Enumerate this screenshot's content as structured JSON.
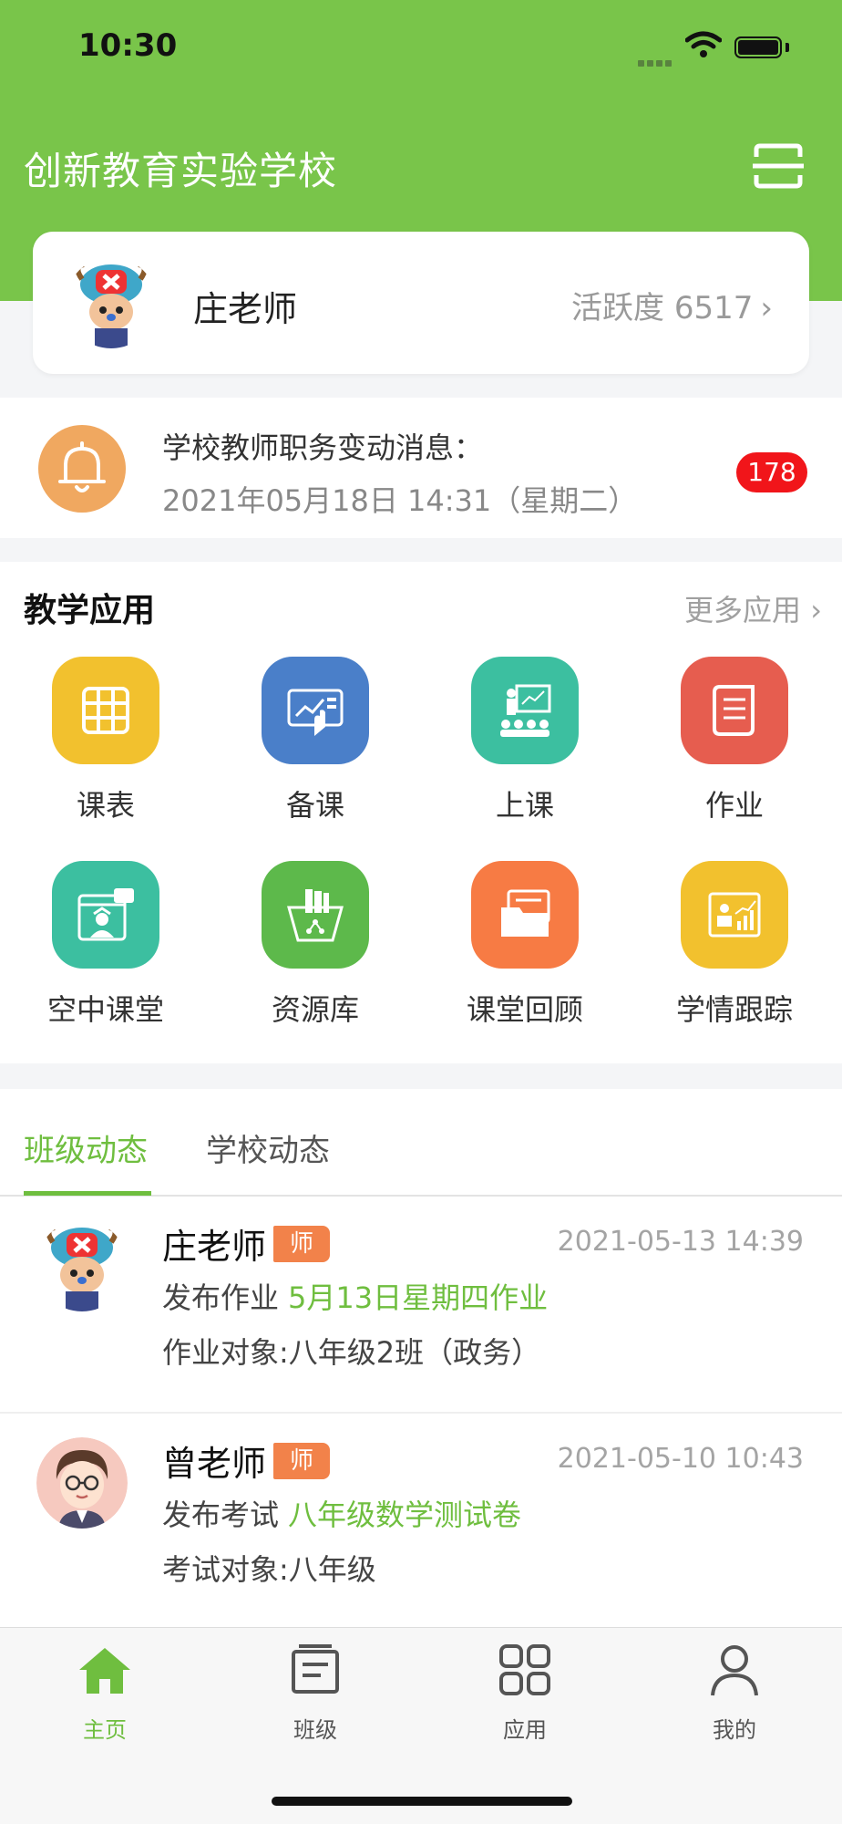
{
  "status_bar": {
    "time": "10:30"
  },
  "header": {
    "school_name": "创新教育实验学校",
    "scan_icon": "scan-icon"
  },
  "profile": {
    "name": "庄老师",
    "activity_label": "活跃度 6517",
    "chevron": "›"
  },
  "notice": {
    "title": "学校教师职务变动消息：",
    "time": "2021年05月18日 14:31（星期二）",
    "badge_count": "178",
    "icon": "bell-icon"
  },
  "apps": {
    "title": "教学应用",
    "more": "更多应用 ›",
    "items": [
      {
        "label": "课表",
        "icon": "timetable-icon",
        "color": "#f2c12e"
      },
      {
        "label": "备课",
        "icon": "lesson-prep-icon",
        "color": "#4a7fc9"
      },
      {
        "label": "上课",
        "icon": "class-icon",
        "color": "#3cbfa0"
      },
      {
        "label": "作业",
        "icon": "homework-icon",
        "color": "#e65d4f"
      },
      {
        "label": "空中课堂",
        "icon": "online-class-icon",
        "color": "#3cbfa0"
      },
      {
        "label": "资源库",
        "icon": "resource-library-icon",
        "color": "#5db94b"
      },
      {
        "label": "课堂回顾",
        "icon": "class-review-icon",
        "color": "#f77b44"
      },
      {
        "label": "学情跟踪",
        "icon": "learning-tracking-icon",
        "color": "#f2c12e"
      }
    ]
  },
  "feed": {
    "tabs": [
      "班级动态",
      "学校动态"
    ],
    "items": [
      {
        "name": "庄老师",
        "role": "师",
        "time": "2021-05-13 14:39",
        "action": "发布作业",
        "link": "5月13日星期四作业",
        "target": "作业对象:八年级2班（政务）"
      },
      {
        "name": "曾老师",
        "role": "师",
        "time": "2021-05-10 10:43",
        "action": "发布考试",
        "link": "八年级数学测试卷",
        "target": "考试对象:八年级"
      }
    ]
  },
  "tab_bar": {
    "items": [
      {
        "label": "主页",
        "icon": "home-icon"
      },
      {
        "label": "班级",
        "icon": "class-board-icon"
      },
      {
        "label": "应用",
        "icon": "apps-grid-icon"
      },
      {
        "label": "我的",
        "icon": "profile-icon"
      }
    ]
  },
  "colors": {
    "brand_green": "#79c54a",
    "accent_green": "#6fbe3f",
    "badge_red": "#f1151a",
    "role_orange": "#f2824a"
  }
}
